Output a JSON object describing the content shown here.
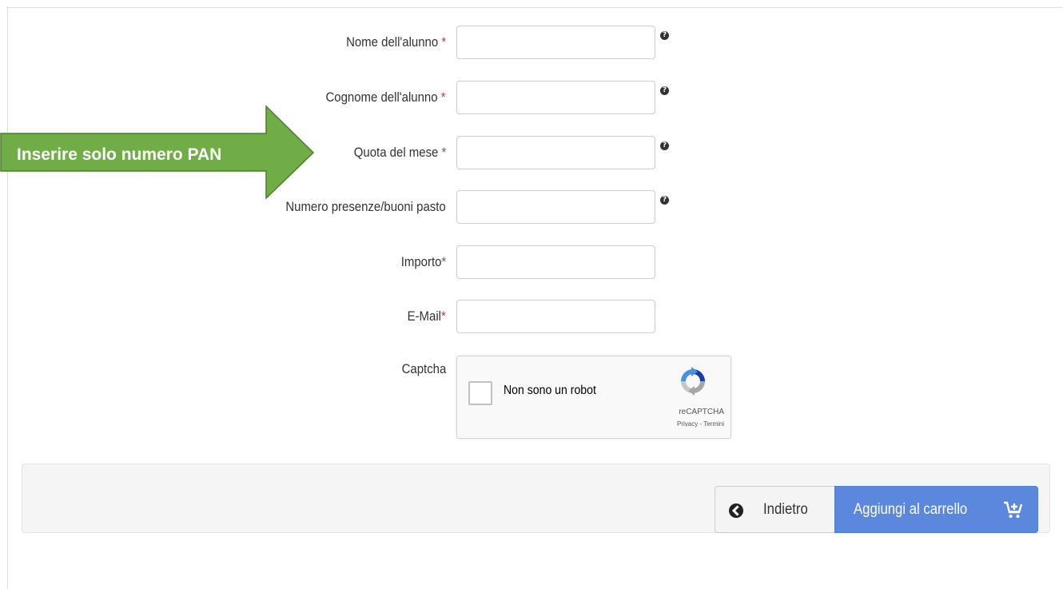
{
  "form": {
    "fields": [
      {
        "label": "Nome dell'alunno ",
        "required_mark": "*",
        "value": "",
        "help_icon": "question-circle"
      },
      {
        "label": "Cognome dell'alunno ",
        "required_mark": "*",
        "value": "",
        "help_icon": "question-circle"
      },
      {
        "label": "Quota del mese ",
        "required_mark": "*",
        "value": "",
        "help_icon": "question-circle"
      },
      {
        "label": "Numero presenze/buoni pasto",
        "required_mark": "",
        "value": "",
        "help_icon": "question-circle"
      },
      {
        "label": "Importo",
        "required_mark": "*",
        "value": ""
      },
      {
        "label": "E-Mail",
        "required_mark": "*",
        "value": ""
      }
    ],
    "captcha_label": "Captcha",
    "help_glyph": "?"
  },
  "recaptcha": {
    "checkbox_label": "Non sono un robot",
    "brand": "reCAPTCHA",
    "links": "Privacy - Termini"
  },
  "footer": {
    "back_label": "Indietro",
    "back_icon": "chevron-left-circle",
    "add_label": "Aggiungi al carrello",
    "add_icon": "cart-plus"
  },
  "annotation": {
    "text": "Inserire solo numero PAN",
    "color": "#70ad47"
  },
  "colors": {
    "required": "#a94442",
    "primary_button": "#5b88dd",
    "footer_bg": "#f5f5f5"
  }
}
